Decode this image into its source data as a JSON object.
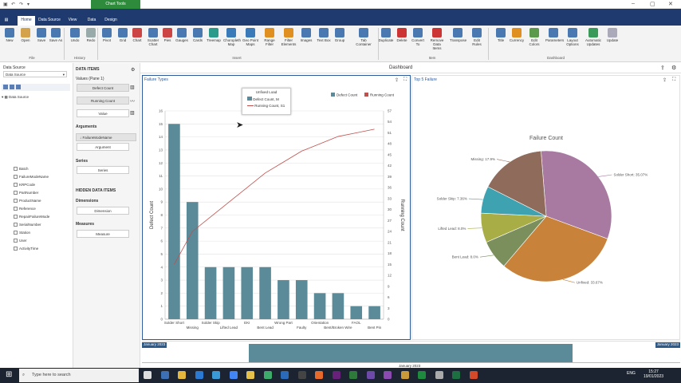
{
  "titlebar": {
    "context_tab": "Chart Tools"
  },
  "tabs": [
    {
      "label": "File"
    },
    {
      "label": "Home"
    },
    {
      "label": "Data Source"
    },
    {
      "label": "View"
    },
    {
      "label": "Data"
    },
    {
      "label": "Design"
    }
  ],
  "ribbon": {
    "buttons": [
      "New",
      "Open",
      "Save",
      "Save As",
      "Undo",
      "Redo",
      "Pivot",
      "Grid",
      "Chart",
      "Scatter Chart",
      "Pies",
      "Gauges",
      "Cards",
      "Treemap",
      "Choropleth Map",
      "Geo Point Maps",
      "Range Filter",
      "Filter Elements",
      "Images",
      "Text Box",
      "Group",
      "Tab Container",
      "Duplicate",
      "Delete",
      "Convert To",
      "Remove Data Items",
      "Transpose",
      "Edit Rules",
      "Title",
      "Currency",
      "Edit Colors",
      "Parameters",
      "Layout Options",
      "Automatic Updates",
      "Update"
    ],
    "groups": [
      "File",
      "History",
      "Insert",
      "Item",
      "Dashboard"
    ]
  },
  "data_source": {
    "label": "Data Source",
    "selected": "Data Source",
    "tree_root": "Data Source",
    "fields": [
      "Batch",
      "FailureModeName",
      "KRPCode",
      "PartNumber",
      "ProductName",
      "Reference",
      "RepairFailureMode",
      "SerialNumber",
      "Station",
      "User",
      "ActivityTime"
    ]
  },
  "data_items": {
    "title": "DATA ITEMS",
    "values_header": "Values (Pane 1)",
    "value_items": [
      "Defect Count",
      "Running Count"
    ],
    "value_placeholder": "Value",
    "arguments_header": "Arguments",
    "argument_item": "FailureModeName",
    "argument_placeholder": "Argument",
    "series_header": "Series",
    "series_placeholder": "Series",
    "hidden_header": "HIDDEN DATA ITEMS",
    "dimensions_header": "Dimensions",
    "dimension_placeholder": "Dimension",
    "measures_header": "Measures",
    "measure_placeholder": "Measure"
  },
  "dashboard": {
    "title": "Dashboard"
  },
  "panel1": {
    "title": "Failure Types",
    "legend_popup": {
      "title": "Unfixed Load",
      "items": [
        "Defect Count, M",
        "Running Count, S1"
      ]
    }
  },
  "panel2": {
    "title": "Top 5 Failure"
  },
  "chart_data": [
    {
      "type": "bar",
      "title": "Failure Types",
      "categories": [
        "Solder Short",
        "Missing",
        "Solder Skip",
        "Lifted Lead",
        "EKI",
        "Bent Lead",
        "Wrong Part",
        "Faulty",
        "Orientation",
        "Bent/Broken Wire",
        "FAOL",
        "Bent Pin"
      ],
      "series": [
        {
          "name": "Defect Count",
          "type": "bar",
          "axis": "left",
          "color": "#5b8a99",
          "values": [
            15,
            9,
            4,
            4,
            4,
            4,
            3,
            3,
            2,
            2,
            1,
            1
          ]
        },
        {
          "name": "Running Count",
          "type": "line",
          "axis": "right",
          "color": "#c0504d",
          "values": [
            15,
            24,
            28,
            32,
            36,
            40,
            43,
            46,
            48,
            50,
            51,
            52
          ]
        }
      ],
      "ylabel": "Defect Count",
      "y2label": "Running Count",
      "ylim": [
        0,
        16
      ],
      "y2lim": [
        0,
        57
      ],
      "yticks": [
        0,
        1,
        2,
        3,
        4,
        5,
        6,
        7,
        8,
        9,
        10,
        11,
        12,
        13,
        14,
        15,
        16
      ],
      "y2ticks": [
        0,
        3,
        6,
        9,
        12,
        15,
        18,
        21,
        24,
        27,
        30,
        33,
        36,
        39,
        42,
        45,
        48,
        51,
        54,
        57
      ],
      "legend": [
        "Defect Count",
        "Running Count"
      ],
      "legend_position": "top-right",
      "grid": true
    },
    {
      "type": "pie",
      "title": "Failure Count",
      "slices": [
        {
          "label": "Solder Short",
          "value": 35.07,
          "color": "#a87aa2"
        },
        {
          "label": "Unfixed",
          "value": 33.67,
          "color": "#c8823a"
        },
        {
          "label": "Bent Lead",
          "value": 8.0,
          "color": "#7b8f5c"
        },
        {
          "label": "Lifted Lead",
          "value": 8.0,
          "color": "#a9ad45"
        },
        {
          "label": "Solder Skip",
          "value": 7.36,
          "color": "#3fa2b0"
        },
        {
          "label": "Missing",
          "value": 17.9,
          "color": "#8f6b5b"
        }
      ],
      "labels": {
        "Solder Short": "Solder Short: 35.07%",
        "Unfixed": "Unfixed: 33.67%",
        "Bent Lead": "Bent Lead: 8.0%",
        "Lifted Lead": "Lifted Lead: 8.0%",
        "Solder Skip": "Solder Skip: 7.36%",
        "Missing": "Missing: 17.9%"
      }
    }
  ],
  "range_filter": {
    "start_label": "January 2023",
    "end_label": "January 2023",
    "axis_label": "January 2023"
  },
  "taskbar": {
    "search_placeholder": "Type here to search",
    "time": "15:27",
    "date": "19/01/2023",
    "lang": "ENG"
  }
}
